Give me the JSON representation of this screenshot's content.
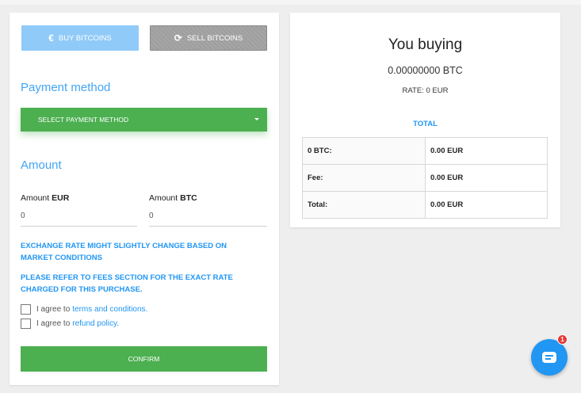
{
  "tabs": {
    "buy": {
      "label": "BUY BITCOINS",
      "icon": "euro-icon"
    },
    "sell": {
      "label": "SELL BITCOINS",
      "icon": "refresh-icon"
    }
  },
  "payment": {
    "title": "Payment method",
    "select_label": "SELECT PAYMENT METHOD"
  },
  "amount": {
    "title": "Amount",
    "eur_label_prefix": "Amount ",
    "eur_label_unit": "EUR",
    "btc_label_prefix": "Amount ",
    "btc_label_unit": "BTC",
    "eur_value": "0",
    "btc_value": "0"
  },
  "notices": {
    "rate_change": "EXCHANGE RATE MIGHT SLIGHTLY CHANGE BASED ON MARKET CONDITIONS",
    "fees": "PLEASE REFER TO FEES SECTION FOR THE EXACT RATE CHARGED FOR THIS PURCHASE."
  },
  "agreements": {
    "terms_prefix": "I agree to",
    "terms_link": "terms and conditions.",
    "refund_prefix": "I agree to",
    "refund_link": "refund policy."
  },
  "confirm_label": "CONFIRM",
  "summary": {
    "title": "You buying",
    "amount": "0.00000000 BTC",
    "rate": "RATE: 0 EUR",
    "total_heading": "TOTAL",
    "rows": [
      {
        "label": "0 BTC:",
        "value": "0.00 EUR"
      },
      {
        "label": "Fee:",
        "value": "0.00 EUR"
      },
      {
        "label": "Total:",
        "value": "0.00 EUR"
      }
    ]
  },
  "chat": {
    "badge": "1",
    "icon": "chat-icon"
  },
  "colors": {
    "accent": "#42a5f5",
    "primary_green": "#4caf50",
    "buy_tab": "#90caf9",
    "sell_tab": "#9e9e9e",
    "badge": "#e53935"
  }
}
